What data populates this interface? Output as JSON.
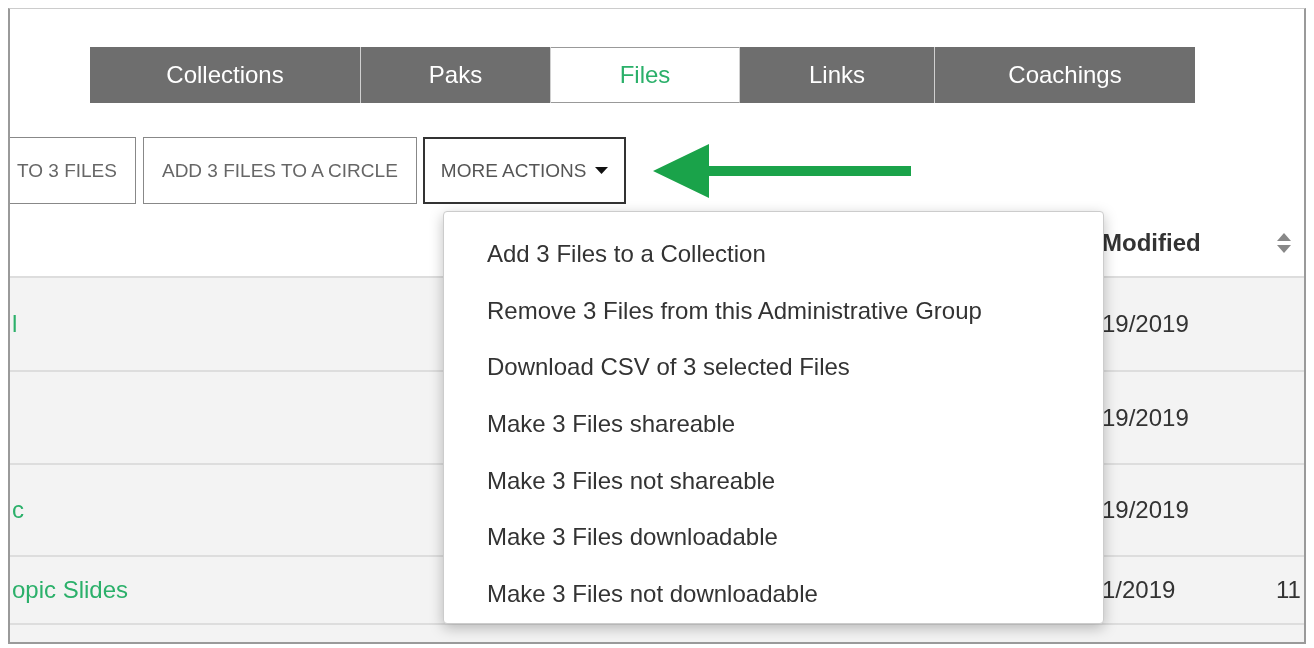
{
  "tabs": [
    {
      "label": "Collections",
      "selected": false
    },
    {
      "label": "Paks",
      "selected": false
    },
    {
      "label": "Files",
      "selected": true
    },
    {
      "label": "Links",
      "selected": false
    },
    {
      "label": "Coachings",
      "selected": false
    }
  ],
  "actions": [
    {
      "label": "TO 3 FILES",
      "kind": "plain"
    },
    {
      "label": "ADD 3 FILES TO A CIRCLE",
      "kind": "plain"
    },
    {
      "label": "MORE ACTIONS",
      "kind": "dropdown",
      "expanded": true
    }
  ],
  "table": {
    "columns": [
      {
        "label": "Modified",
        "sortable": false
      },
      {
        "sortable": true
      }
    ],
    "rows": [
      {
        "name": "l",
        "modified": "19/2019"
      },
      {
        "modified": "19/2019"
      },
      {
        "name": "c",
        "modified": "19/2019"
      },
      {
        "name": "opic Slides",
        "modified": "1/2019",
        "column_3": "11"
      }
    ]
  },
  "menu": {
    "items": [
      "Add 3 Files to a Collection",
      "Remove 3 Files from this Administrative Group",
      "Download CSV of 3 selected Files",
      "Make 3 Files shareable",
      "Make 3 Files not shareable",
      "Make 3 Files downloadable",
      "Make 3 Files not downloadable"
    ]
  }
}
